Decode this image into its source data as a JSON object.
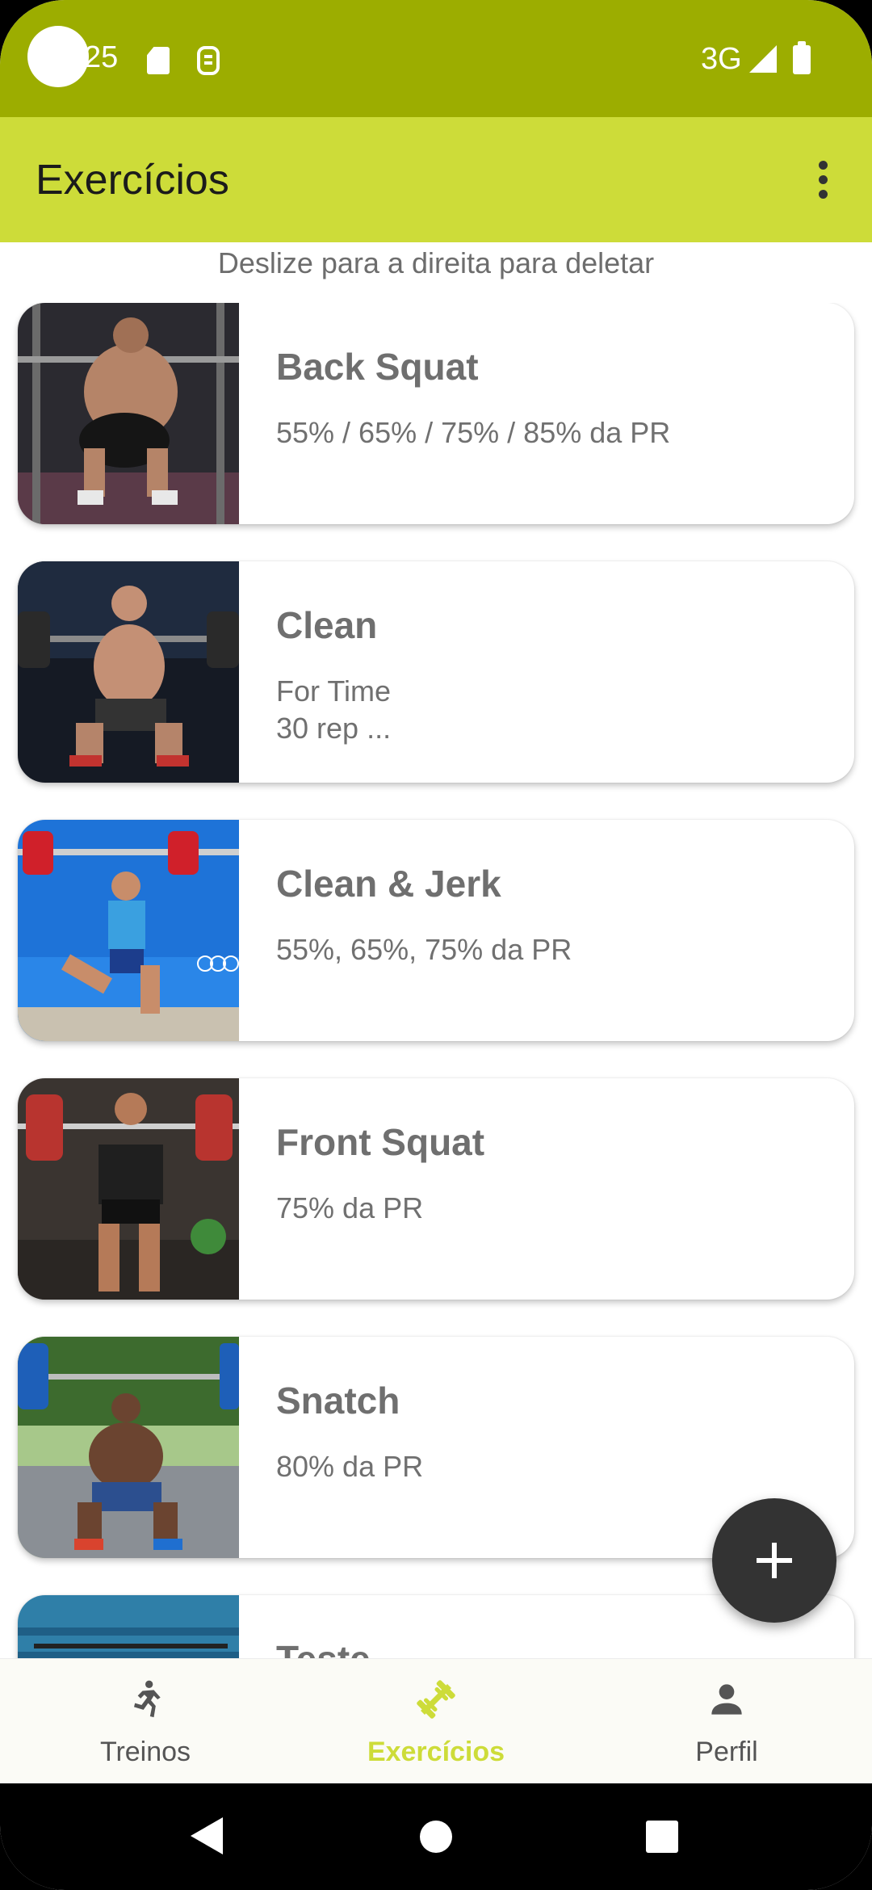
{
  "status_bar": {
    "time": "25",
    "network": "3G"
  },
  "app_bar": {
    "title": "Exercícios"
  },
  "hint": "Deslize para a direita para deletar",
  "exercises": [
    {
      "title": "Back Squat",
      "description": "55% / 65% / 75% / 85% da PR"
    },
    {
      "title": "Clean",
      "description": "For Time\n30 rep ..."
    },
    {
      "title": "Clean & Jerk",
      "description": "55%, 65%, 75% da PR"
    },
    {
      "title": "Front Squat",
      "description": "75% da PR"
    },
    {
      "title": "Snatch",
      "description": "80% da PR"
    },
    {
      "title": "Teste",
      "description": ""
    }
  ],
  "bottom_nav": {
    "items": [
      {
        "label": "Treinos",
        "icon": "run-icon"
      },
      {
        "label": "Exercícios",
        "icon": "dumbbell-icon",
        "active": true
      },
      {
        "label": "Perfil",
        "icon": "person-icon"
      }
    ]
  },
  "colors": {
    "status_bar": "#9cad00",
    "app_bar": "#cddc39",
    "active_nav": "#cddc39",
    "fab": "#333333"
  }
}
